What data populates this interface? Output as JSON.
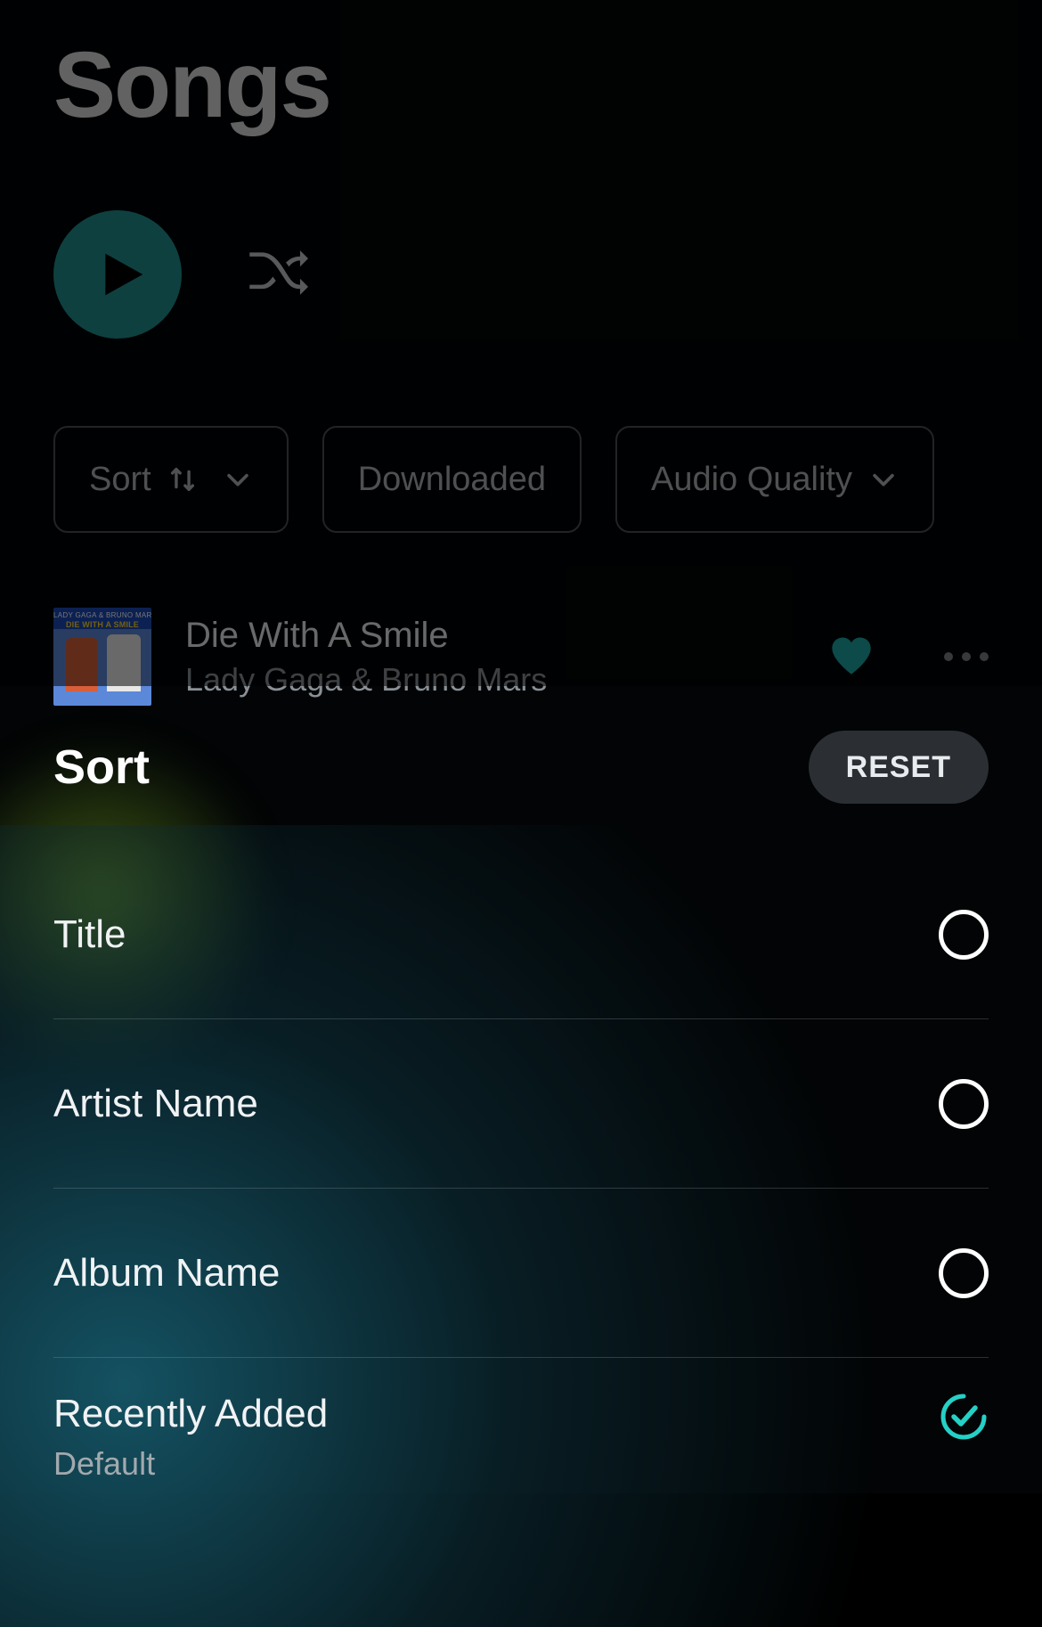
{
  "header": {
    "title": "Songs"
  },
  "filters": {
    "sort_label": "Sort",
    "downloaded_label": "Downloaded",
    "audio_quality_label": "Audio Quality"
  },
  "song": {
    "title": "Die With A Smile",
    "artist": "Lady Gaga & Bruno Mars",
    "cover_top": "LADY GAGA & BRUNO MARS",
    "cover_title": "DIE WITH A SMILE",
    "liked": true
  },
  "sort_sheet": {
    "title": "Sort",
    "reset_label": "RESET",
    "options": [
      {
        "label": "Title",
        "selected": false
      },
      {
        "label": "Artist Name",
        "selected": false
      },
      {
        "label": "Album Name",
        "selected": false
      },
      {
        "label": "Recently Added",
        "sub": "Default",
        "selected": true
      }
    ]
  },
  "colors": {
    "accent": "#25d0c6",
    "play": "#1f8f8f"
  }
}
